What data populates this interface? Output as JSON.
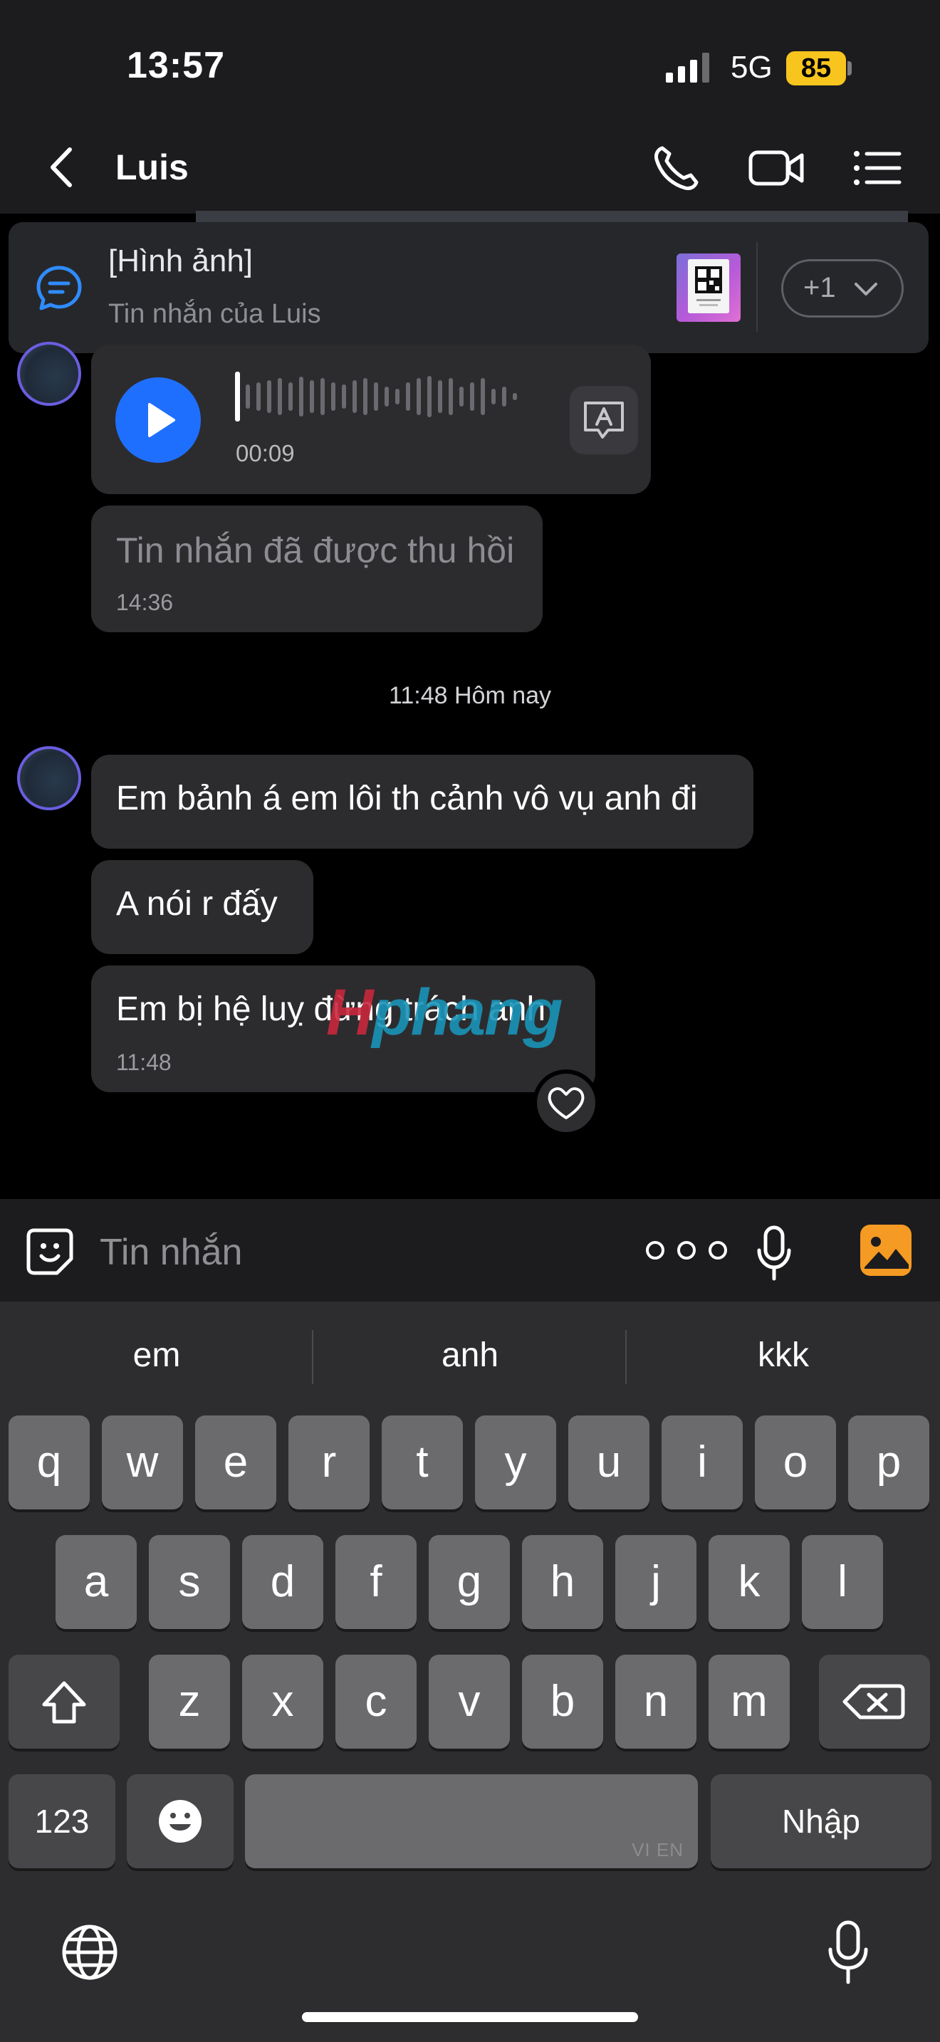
{
  "status_bar": {
    "time": "13:57",
    "network": "5G",
    "battery": "85"
  },
  "header": {
    "contact_name": "Luis"
  },
  "pinned": {
    "title": "[Hình ảnh]",
    "subtitle": "Tin nhắn của Luis",
    "more_count": "+1"
  },
  "messages": {
    "voice": {
      "duration": "00:09"
    },
    "recalled": {
      "text": "Tin nhắn đã được thu hồi",
      "time": "14:36"
    },
    "date_separator": "11:48 Hôm nay",
    "items": [
      {
        "text": "Em bảnh á em lôi th cảnh vô vụ anh đi"
      },
      {
        "text": "A nói r đấy"
      },
      {
        "text": "Em bị hệ luỵ đừng trách anh",
        "time": "11:48"
      }
    ]
  },
  "watermark": {
    "red_part": "H",
    "blue_part": "phang"
  },
  "input": {
    "placeholder": "Tin nhắn"
  },
  "keyboard": {
    "suggestions": [
      "em",
      "anh",
      "kkk"
    ],
    "row1": [
      "q",
      "w",
      "e",
      "r",
      "t",
      "y",
      "u",
      "i",
      "o",
      "p"
    ],
    "row2": [
      "a",
      "s",
      "d",
      "f",
      "g",
      "h",
      "j",
      "k",
      "l"
    ],
    "row3": [
      "z",
      "x",
      "c",
      "v",
      "b",
      "n",
      "m"
    ],
    "numbers_label": "123",
    "return_label": "Nhập",
    "space_label": "VI EN"
  },
  "colors": {
    "accent_blue": "#1f6fff",
    "battery_yellow": "#f7c51e",
    "gallery_orange": "#f59a23"
  }
}
